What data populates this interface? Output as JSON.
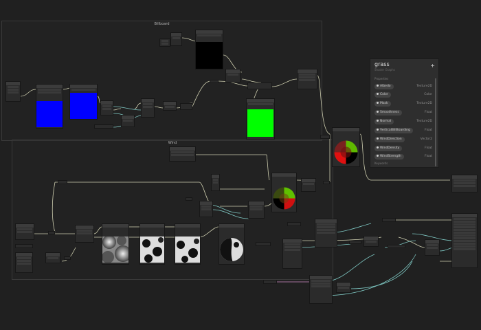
{
  "graph": {
    "groups": {
      "billboard": "Billboard",
      "wind": "Wind"
    }
  },
  "blackboard": {
    "title": "grass",
    "subtitle": "Shader Graphs",
    "add_label": "+",
    "properties_header": "Properties",
    "properties": [
      {
        "name": "Albedo",
        "type": "Texture2D"
      },
      {
        "name": "Color",
        "type": "Color"
      },
      {
        "name": "Mask",
        "type": "Texture2D"
      },
      {
        "name": "Smoothness",
        "type": "Float"
      },
      {
        "name": "Normal",
        "type": "Texture2D"
      },
      {
        "name": "VerticalBillBoarding",
        "type": "Float"
      },
      {
        "name": "WindDirection",
        "type": "Vector2"
      },
      {
        "name": "WindDensity",
        "type": "Float"
      },
      {
        "name": "WindStrength",
        "type": "Float"
      }
    ],
    "keywords_header": "Keywords"
  },
  "colors": {
    "background": "#202020",
    "node": "#2b2b2b",
    "wire": "#cfcfb0",
    "wire_teal": "#7fc9c4",
    "preview_blue": "#0000ff",
    "preview_green": "#00ff00"
  }
}
